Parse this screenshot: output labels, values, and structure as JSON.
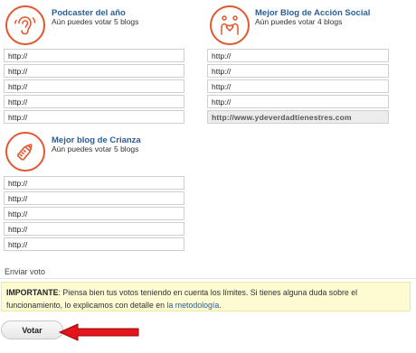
{
  "categories": [
    {
      "title": "Podcaster del año",
      "subtitle": "Aún puedes votar 5 blogs",
      "icon": "ear-icon",
      "inputs": [
        "http://",
        "http://",
        "http://",
        "http://",
        "http://"
      ]
    },
    {
      "title": "Mejor Blog de Acción Social",
      "subtitle": "Aún puedes votar 4 blogs",
      "icon": "heart-hands-icon",
      "inputs": [
        "http://",
        "http://",
        "http://",
        "http://",
        "http://www.ydeverdadtienestres.com"
      ]
    },
    {
      "title": "Mejor blog de Crianza",
      "subtitle": "Aún puedes votar 5 blogs",
      "icon": "baby-bottle-icon",
      "inputs": [
        "http://",
        "http://",
        "http://",
        "http://",
        "http://"
      ]
    }
  ],
  "submit_section": {
    "label": "Enviar voto",
    "notice_strong": "IMPORTANTE",
    "notice_text": ": Piensa bien tus votos teniendo en cuenta los límites. Si tienes alguna duda sobre el funcionamiento, lo explicamos con detalle en ",
    "notice_link": "la metodología",
    "notice_end": ".",
    "vote_button": "Votar"
  },
  "colors": {
    "accent": "#e4572e",
    "title": "#2a5d9a",
    "notice_bg": "#fdfbd2",
    "arrow": "#e3141b"
  }
}
